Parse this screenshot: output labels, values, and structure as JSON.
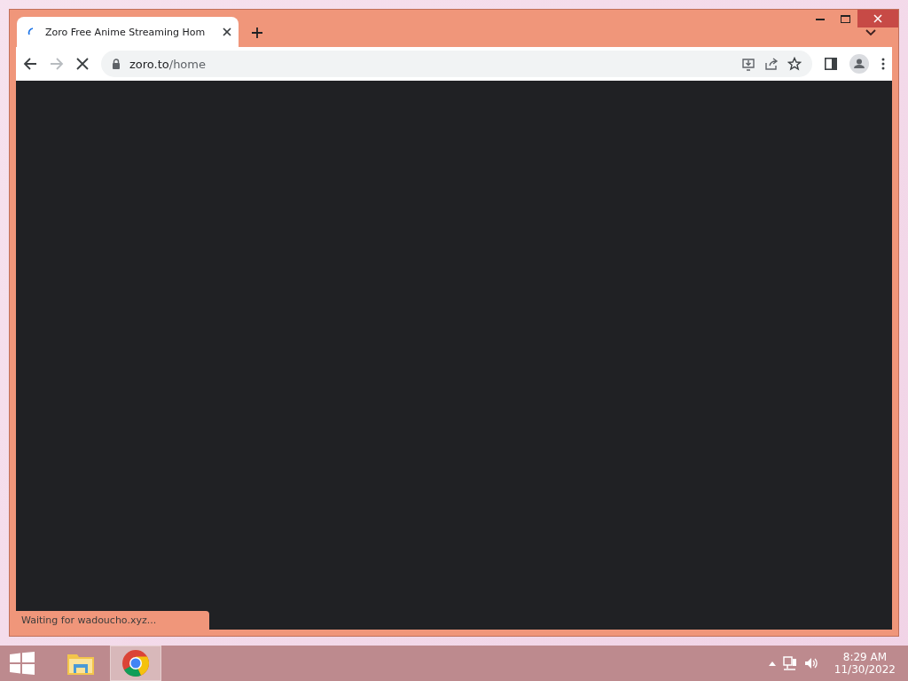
{
  "browser": {
    "tabs": [
      {
        "title": "Zoro Free Anime Streaming Hom",
        "selected": true,
        "loading": true
      }
    ],
    "address": {
      "host": "zoro.to",
      "path": "/home"
    },
    "status": "Waiting for wadoucho.xyz..."
  },
  "taskbar": {
    "apps": [
      {
        "kind": "explorer",
        "selected": false
      },
      {
        "kind": "chrome",
        "selected": true
      }
    ],
    "clock": {
      "time": "8:29 AM",
      "date": "11/30/2022"
    }
  }
}
